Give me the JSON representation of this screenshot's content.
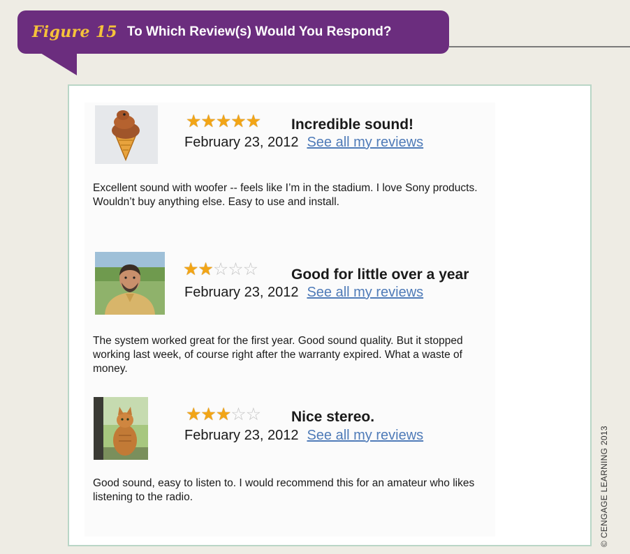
{
  "figure": {
    "label": "Figure 15",
    "title": "To Which Review(s) Would You Respond?"
  },
  "copyright": "© CENGAGE LEARNING 2013",
  "reviews": [
    {
      "avatar": "ice-cream-cone-avatar",
      "rating": 5,
      "max_rating": 5,
      "stars": {
        "filled": "★★★★★",
        "empty": ""
      },
      "headline": "Incredible sound!",
      "date": "February 23, 2012",
      "link_label": "See all my reviews",
      "text": "Excellent sound with woofer -- feels like I’m in the stadium. I love Sony products. Wouldn’t buy anything else. Easy to use and install."
    },
    {
      "avatar": "man-portrait-avatar",
      "rating": 2,
      "max_rating": 5,
      "stars": {
        "filled": "★★",
        "empty": "☆☆☆"
      },
      "headline": "Good for little over a year",
      "date": "February 23, 2012",
      "link_label": "See all my reviews",
      "text": "The system worked great for the first year. Good sound quality. But it stopped working last week, of course right after the warranty expired. What a waste of money."
    },
    {
      "avatar": "cat-photo-avatar",
      "rating": 3,
      "max_rating": 5,
      "stars": {
        "filled": "★★★",
        "empty": "☆☆"
      },
      "headline": "Nice stereo.",
      "date": "February 23, 2012",
      "link_label": "See all my reviews",
      "text": "Good sound, easy to listen to. I would recommend this for an amateur who likes listening to the radio."
    }
  ]
}
